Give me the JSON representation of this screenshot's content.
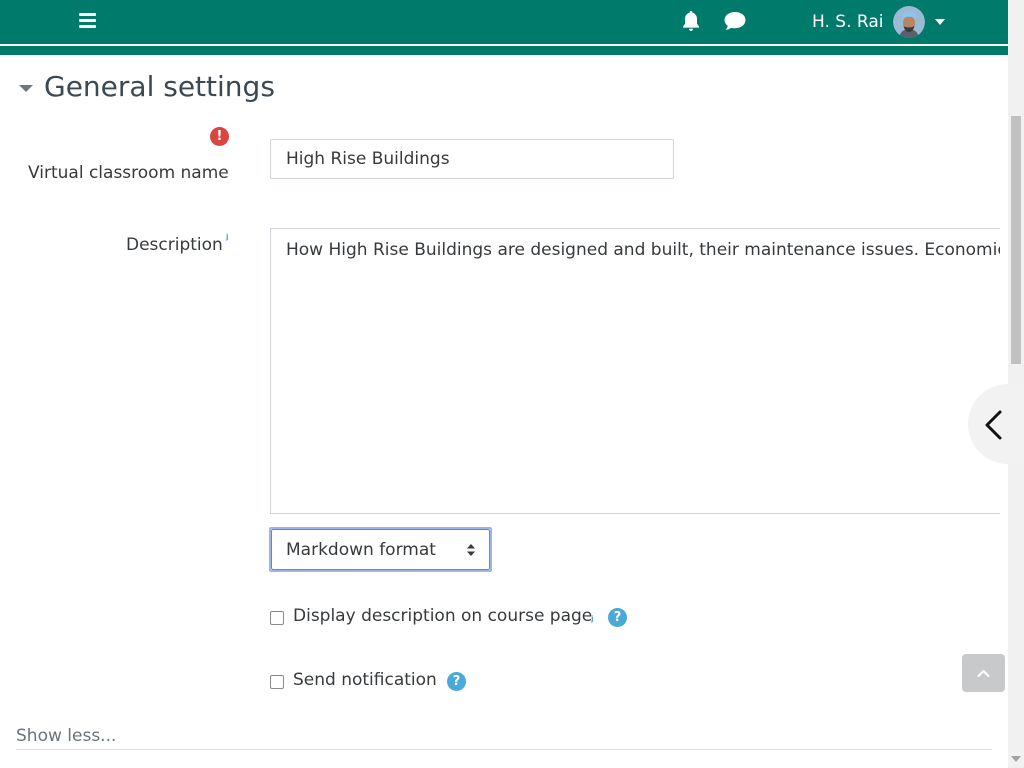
{
  "navbar": {
    "user_name": "H. S. Rai",
    "icons": {
      "menu": "hamburger-icon",
      "notifications": "bell-icon",
      "messages": "chat-icon",
      "user_dropdown": "caret-down-icon"
    },
    "color": "#007b6b"
  },
  "section": {
    "title": "General settings",
    "collapse_icon": "caret-down-icon"
  },
  "form": {
    "vc_name": {
      "label": "Virtual classroom name",
      "value": "High Rise Buildings",
      "required_icon": "exclamation-circle-icon"
    },
    "description": {
      "label": "Description",
      "value": "How High Rise Buildings are designed and built, their maintenance issues. Economica"
    },
    "format": {
      "selected": "Markdown format"
    },
    "display_description": {
      "label": "Display description on course page",
      "checked": false
    },
    "send_notification": {
      "label": "Send notification",
      "checked": false
    }
  },
  "footer": {
    "show_less": "Show less..."
  },
  "colors": {
    "help": "#4aa9d8",
    "required": "#d9463f",
    "focus": "#4d8de0"
  }
}
